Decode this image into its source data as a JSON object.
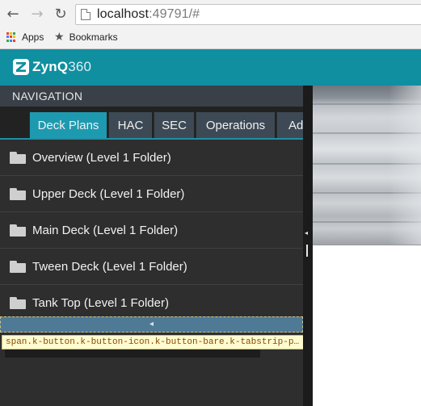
{
  "browser": {
    "url_host": "localhost",
    "url_rest": ":49791/#",
    "bookmarks_bar": {
      "apps_label": "Apps",
      "bookmarks_label": "Bookmarks"
    },
    "apps_colors": [
      "#ea4335",
      "#fbbc05",
      "#34a853",
      "#4285f4",
      "#ea4335",
      "#fbbc05",
      "#34a853",
      "#4285f4",
      "#ea4335"
    ]
  },
  "app": {
    "logo_text": "ZynQ",
    "logo_num": "360",
    "brand_color": "#0f8fa0"
  },
  "navigation": {
    "title": "NAVIGATION",
    "tabs": [
      {
        "label": "Deck Plans",
        "active": true
      },
      {
        "label": "HAC",
        "active": false
      },
      {
        "label": "SEC",
        "active": false
      },
      {
        "label": "Operations",
        "active": false
      },
      {
        "label": "Ad",
        "active": false
      }
    ],
    "folders": [
      {
        "label": "Overview (Level 1 Folder)"
      },
      {
        "label": "Upper Deck (Level 1 Folder)"
      },
      {
        "label": "Main Deck (Level 1 Folder)"
      },
      {
        "label": "Tween Deck (Level 1 Folder)"
      },
      {
        "label": "Tank Top (Level 1 Folder)"
      }
    ],
    "scroll_arrow": "◂"
  },
  "devtools_tooltip": {
    "selector": "span.k-button.k-button-icon.k-button-bare.k-tabstrip-p…",
    "width": "375",
    "height": "20",
    "unit": "px",
    "times": "×"
  }
}
